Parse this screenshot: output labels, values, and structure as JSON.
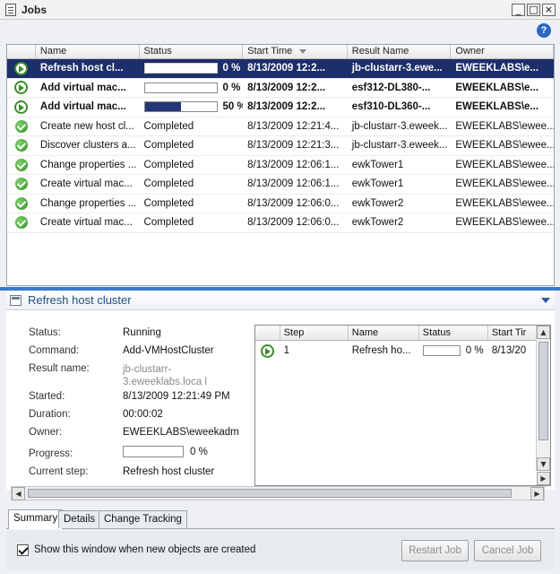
{
  "window": {
    "title": "Jobs",
    "controls": {
      "minimize": "_",
      "restore": "□",
      "close": "×"
    },
    "help_glyph": "?"
  },
  "jobs_grid": {
    "columns": [
      "",
      "Name",
      "Status",
      "Start Time",
      "Result Name",
      "Owner"
    ],
    "rows": [
      {
        "icon": "play-icon",
        "name": "Refresh host cl...",
        "status_type": "progress",
        "progress": 0,
        "pct": "0 %",
        "start": "8/13/2009 12:2...",
        "result": "jb-clustarr-3.ewe...",
        "owner": "EWEEKLABS\\e...",
        "bold": true,
        "selected": true
      },
      {
        "icon": "play-icon",
        "name": "Add virtual mac...",
        "status_type": "progress",
        "progress": 0,
        "pct": "0 %",
        "start": "8/13/2009 12:2...",
        "result": "esf312-DL380-...",
        "owner": "EWEEKLABS\\e...",
        "bold": true,
        "selected": false
      },
      {
        "icon": "play-icon",
        "name": "Add virtual mac...",
        "status_type": "progress",
        "progress": 50,
        "pct": "50 %",
        "start": "8/13/2009 12:2...",
        "result": "esf310-DL360-...",
        "owner": "EWEEKLABS\\e...",
        "bold": true,
        "selected": false
      },
      {
        "icon": "check-icon",
        "name": "Create new host cl...",
        "status_type": "text",
        "status": "Completed",
        "start": "8/13/2009 12:21:4...",
        "result": "jb-clustarr-3.eweek...",
        "owner": "EWEEKLABS\\ewee...",
        "bold": false,
        "selected": false
      },
      {
        "icon": "check-icon",
        "name": "Discover clusters a...",
        "status_type": "text",
        "status": "Completed",
        "start": "8/13/2009 12:21:3...",
        "result": "jb-clustarr-3.eweek...",
        "owner": "EWEEKLABS\\ewee...",
        "bold": false,
        "selected": false
      },
      {
        "icon": "check-icon",
        "name": "Change properties ...",
        "status_type": "text",
        "status": "Completed",
        "start": "8/13/2009 12:06:1...",
        "result": "ewkTower1",
        "owner": "EWEEKLABS\\ewee...",
        "bold": false,
        "selected": false
      },
      {
        "icon": "check-icon",
        "name": "Create virtual mac...",
        "status_type": "text",
        "status": "Completed",
        "start": "8/13/2009 12:06:1...",
        "result": "ewkTower1",
        "owner": "EWEEKLABS\\ewee...",
        "bold": false,
        "selected": false
      },
      {
        "icon": "check-icon",
        "name": "Change properties ...",
        "status_type": "text",
        "status": "Completed",
        "start": "8/13/2009 12:06:0...",
        "result": "ewkTower2",
        "owner": "EWEEKLABS\\ewee...",
        "bold": false,
        "selected": false
      },
      {
        "icon": "check-icon",
        "name": "Create virtual mac...",
        "status_type": "text",
        "status": "Completed",
        "start": "8/13/2009 12:06:0...",
        "result": "ewkTower2",
        "owner": "EWEEKLABS\\ewee...",
        "bold": false,
        "selected": false
      }
    ]
  },
  "details": {
    "title": "Refresh host cluster",
    "fields": {
      "status_label": "Status:",
      "status": "Running",
      "command_label": "Command:",
      "command": "Add-VMHostCluster",
      "result_label": "Result name:",
      "result": "jb-clustarr-3.eweeklabs.loca l",
      "started_label": "Started:",
      "started": "8/13/2009 12:21:49 PM",
      "duration_label": "Duration:",
      "duration": "00:00:02",
      "owner_label": "Owner:",
      "owner": "EWEEKLABS\\eweekadm",
      "progress_label": "Progress:",
      "progress": "0 %",
      "progress_value": 0,
      "current_step_label": "Current step:",
      "current_step": "Refresh host cluster"
    },
    "steps": {
      "columns": [
        "",
        "Step",
        "Name",
        "Status",
        "Start Tir"
      ],
      "rows": [
        {
          "step": "1",
          "name": "Refresh ho...",
          "progress": 0,
          "pct": "0 %",
          "start": "8/13/20"
        }
      ]
    }
  },
  "tabs": [
    "Summary",
    "Details",
    "Change Tracking"
  ],
  "footer": {
    "checkbox_label": "Show this window when new objects are created",
    "checkbox_checked": true,
    "restart_label": "Restart Job",
    "cancel_label": "Cancel Job"
  },
  "colors": {
    "selection": "#1c2f6a",
    "accent": "#3a7bc8",
    "progress_fill": "#233777"
  }
}
